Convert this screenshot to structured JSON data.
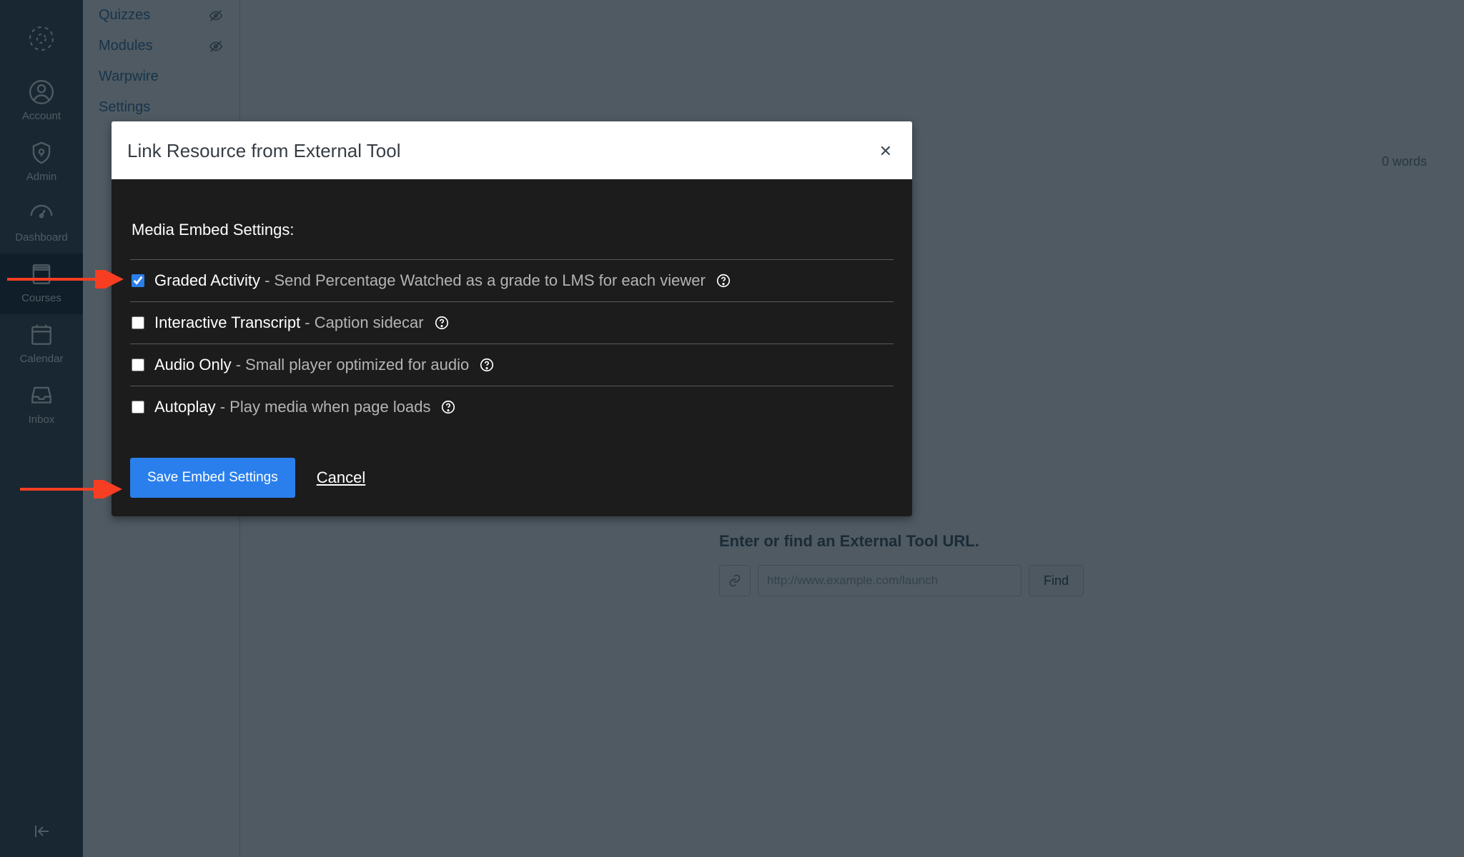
{
  "global_nav": {
    "items": [
      {
        "label": "Account"
      },
      {
        "label": "Admin"
      },
      {
        "label": "Dashboard"
      },
      {
        "label": "Courses"
      },
      {
        "label": "Calendar"
      },
      {
        "label": "Inbox"
      }
    ]
  },
  "course_sidebar": {
    "items": [
      {
        "label": "Quizzes",
        "hidden": true
      },
      {
        "label": "Modules",
        "hidden": true
      },
      {
        "label": "Warpwire",
        "hidden": false
      },
      {
        "label": "Settings",
        "hidden": false
      }
    ]
  },
  "editor": {
    "word_count": "0 words"
  },
  "external_tool": {
    "heading": "Enter or find an External Tool URL.",
    "placeholder": "http://www.example.com/launch",
    "find_label": "Find"
  },
  "modal": {
    "title": "Link Resource from External Tool",
    "section_heading": "Media Embed Settings:",
    "settings": [
      {
        "checked": true,
        "title": "Graded Activity",
        "desc": " - Send Percentage Watched as a grade to LMS for each viewer"
      },
      {
        "checked": false,
        "title": "Interactive Transcript",
        "desc": " - Caption sidecar"
      },
      {
        "checked": false,
        "title": "Audio Only",
        "desc": " - Small player optimized for audio"
      },
      {
        "checked": false,
        "title": "Autoplay",
        "desc": " - Play media when page loads"
      }
    ],
    "save_label": "Save Embed Settings",
    "cancel_label": "Cancel"
  }
}
